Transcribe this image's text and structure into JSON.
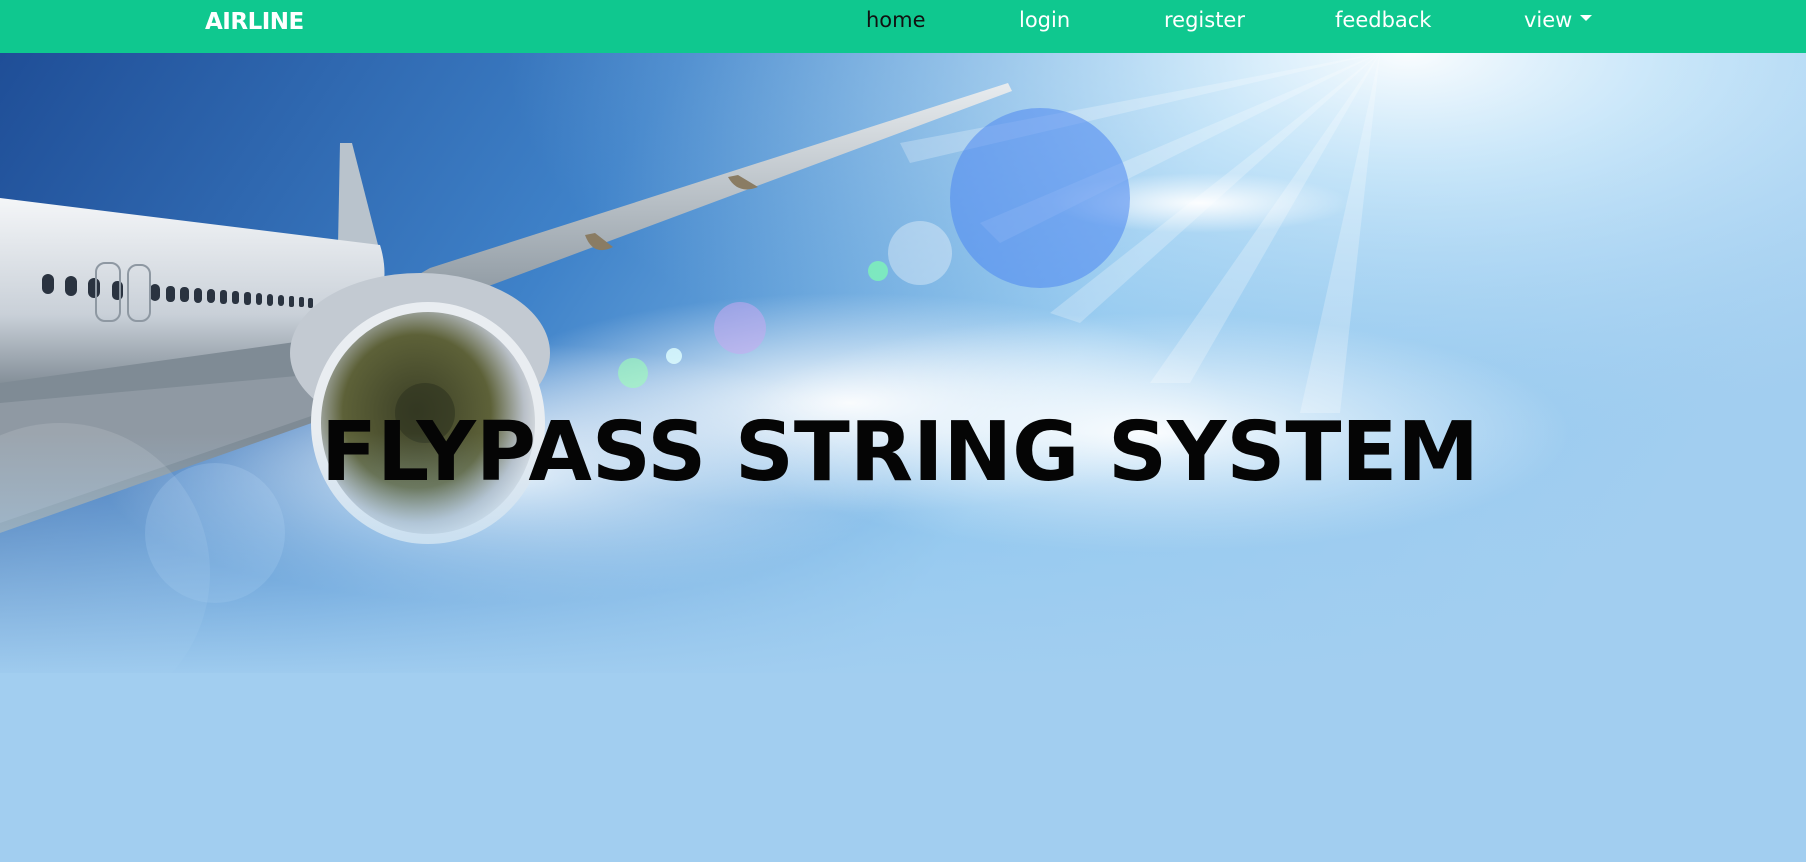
{
  "navbar": {
    "brand": "AIRLINE",
    "links": [
      {
        "label": "home",
        "active": true
      },
      {
        "label": "login",
        "active": false
      },
      {
        "label": "register",
        "active": false
      },
      {
        "label": "feedback",
        "active": false
      },
      {
        "label": "view",
        "active": false,
        "dropdown": true
      }
    ]
  },
  "hero": {
    "title": "FLYPASS STRING SYSTEM",
    "image": "airplane-wing-sky"
  },
  "colors": {
    "navbar_bg": "#0fc88f",
    "nav_text": "#ffffff",
    "nav_active_text": "#111111",
    "hero_bg": "#a2cef0",
    "title_text": "#050505"
  },
  "icons": {
    "dropdown": "caret-down-icon"
  }
}
